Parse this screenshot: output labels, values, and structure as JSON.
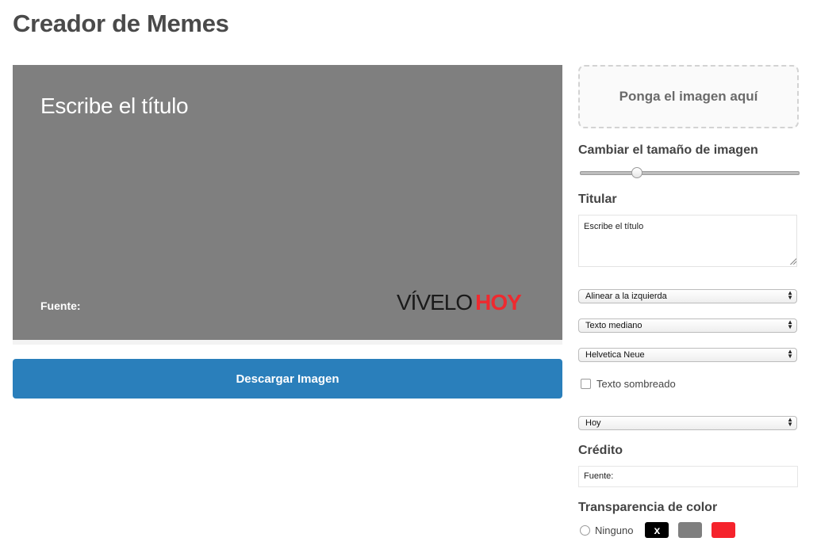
{
  "page": {
    "title": "Creador de Memes"
  },
  "preview": {
    "title_text": "Escribe el título",
    "credit_text": "Fuente:",
    "brand": {
      "part1": "VÍVELO",
      "part2": "HOY"
    },
    "background_color": "#7f7f7f"
  },
  "actions": {
    "download_label": "Descargar Imagen"
  },
  "dropzone": {
    "label": "Ponga el imagen aquí"
  },
  "resize": {
    "label": "Cambiar el tamaño de imagen",
    "value_fraction": 0.26
  },
  "headline": {
    "label": "Titular",
    "value": "Escribe el título"
  },
  "selects": {
    "alignment": "Alinear a la izquierda",
    "text_size": "Texto mediano",
    "font": "Helvetica Neue",
    "logo": "Hoy"
  },
  "shadow_checkbox": {
    "label": "Texto sombreado",
    "checked": false
  },
  "credit": {
    "label": "Crédito",
    "value": "Fuente:"
  },
  "color_transparency": {
    "label": "Transparencia de color",
    "none_label": "Ninguno",
    "swatches": [
      {
        "name": "black",
        "color": "#000000",
        "text": "x"
      },
      {
        "name": "gray",
        "color": "#7f7f7f",
        "text": ""
      },
      {
        "name": "red",
        "color": "#f5232c",
        "text": ""
      }
    ]
  },
  "colors": {
    "accent": "#2a7fbb",
    "brand_red": "#ee2a2f"
  }
}
